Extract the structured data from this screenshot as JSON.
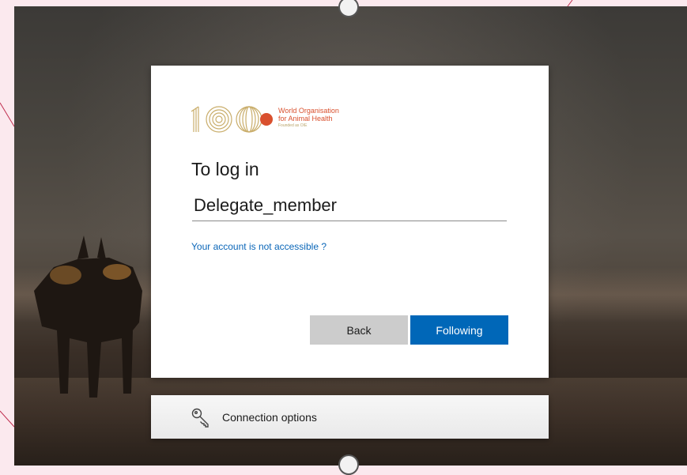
{
  "logo": {
    "number": "100",
    "org_line1": "World Organisation",
    "org_line2": "for Animal Health",
    "org_tagline": "Founded as OIE"
  },
  "signin": {
    "title": "To log in",
    "username_value": "Delegate_member",
    "help_link": "Your account is not accessible ?",
    "back_label": "Back",
    "next_label": "Following"
  },
  "options": {
    "label": "Connection options",
    "icon": "key-icon"
  },
  "colors": {
    "primary": "#0067b8",
    "link": "#0a66b8",
    "secondary_button": "#cccccc",
    "logo_text": "#d9502e",
    "logo_gold": "#c9ad6a"
  }
}
